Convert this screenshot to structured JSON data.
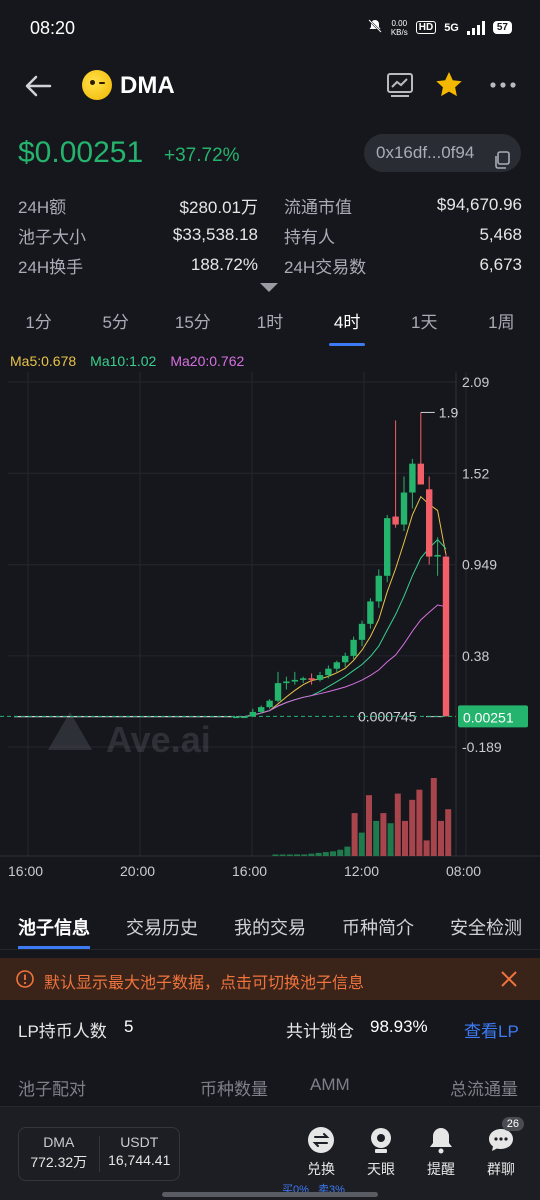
{
  "status_bar": {
    "time": "08:20",
    "net_speed_value": "0.00",
    "net_speed_unit": "KB/s",
    "hd": "HD",
    "network": "5G",
    "battery": "57"
  },
  "header": {
    "token": "DMA",
    "logo_icon": "smile-coin-icon"
  },
  "price": {
    "value": "$0.00251",
    "change": "+37.72%",
    "address": "0x16df...0f94"
  },
  "stats": [
    {
      "label": "24H额",
      "value": "$280.01万",
      "label2": "流通市值",
      "value2": "$94,670.96"
    },
    {
      "label": "池子大小",
      "value": "$33,538.18",
      "label2": "持有人",
      "value2": "5,468"
    },
    {
      "label": "24H换手",
      "value": "188.72%",
      "label2": "24H交易数",
      "value2": "6,673"
    }
  ],
  "timeframes": [
    "1分",
    "5分",
    "15分",
    "1时",
    "4时",
    "1天",
    "1周"
  ],
  "active_timeframe": "4时",
  "ma_legend": {
    "ma5": "Ma5:0.678",
    "ma10": "Ma10:1.02",
    "ma20": "Ma20:0.762"
  },
  "colors": {
    "up": "#25b46e",
    "down": "#f35f68",
    "ma5": "#e8c24a",
    "ma10": "#3ad08f",
    "ma20": "#d670e0",
    "accent": "#3d7bf5"
  },
  "chart_data": {
    "type": "candlestick",
    "y_ticks": [
      "2.09",
      "1.52",
      "0.949",
      "0.38",
      "-0.189"
    ],
    "x_ticks": [
      "16:00",
      "20:00",
      "16:00",
      "12:00",
      "08:00"
    ],
    "high_label": "1.9",
    "low_label": "0.000745",
    "last_price_label": "0.00251",
    "watermark": "Ave.ai",
    "ylim": [
      -0.189,
      2.09
    ],
    "candles": [
      {
        "o": 0.0008,
        "h": 0.0009,
        "l": 0.0007,
        "c": 0.0009
      },
      {
        "o": 0.0009,
        "h": 0.001,
        "l": 0.0008,
        "c": 0.001
      },
      {
        "o": 0.001,
        "h": 0.05,
        "l": 0.0009,
        "c": 0.03
      },
      {
        "o": 0.03,
        "h": 0.07,
        "l": 0.02,
        "c": 0.06
      },
      {
        "o": 0.06,
        "h": 0.11,
        "l": 0.05,
        "c": 0.1
      },
      {
        "o": 0.1,
        "h": 0.28,
        "l": 0.09,
        "c": 0.21
      },
      {
        "o": 0.21,
        "h": 0.25,
        "l": 0.17,
        "c": 0.22
      },
      {
        "o": 0.22,
        "h": 0.28,
        "l": 0.2,
        "c": 0.23
      },
      {
        "o": 0.23,
        "h": 0.25,
        "l": 0.21,
        "c": 0.24
      },
      {
        "o": 0.24,
        "h": 0.27,
        "l": 0.2,
        "c": 0.23
      },
      {
        "o": 0.23,
        "h": 0.28,
        "l": 0.22,
        "c": 0.26
      },
      {
        "o": 0.26,
        "h": 0.32,
        "l": 0.24,
        "c": 0.3
      },
      {
        "o": 0.3,
        "h": 0.35,
        "l": 0.28,
        "c": 0.34
      },
      {
        "o": 0.34,
        "h": 0.4,
        "l": 0.31,
        "c": 0.38
      },
      {
        "o": 0.38,
        "h": 0.5,
        "l": 0.36,
        "c": 0.48
      },
      {
        "o": 0.48,
        "h": 0.6,
        "l": 0.44,
        "c": 0.58
      },
      {
        "o": 0.58,
        "h": 0.74,
        "l": 0.55,
        "c": 0.72
      },
      {
        "o": 0.72,
        "h": 0.92,
        "l": 0.68,
        "c": 0.88
      },
      {
        "o": 0.88,
        "h": 1.26,
        "l": 0.84,
        "c": 1.24
      },
      {
        "o": 1.25,
        "h": 1.85,
        "l": 1.18,
        "c": 1.2
      },
      {
        "o": 1.2,
        "h": 1.5,
        "l": 1.16,
        "c": 1.4
      },
      {
        "o": 1.4,
        "h": 1.61,
        "l": 1.3,
        "c": 1.58
      },
      {
        "o": 1.58,
        "h": 1.9,
        "l": 1.5,
        "c": 1.45
      },
      {
        "o": 1.42,
        "h": 1.5,
        "l": 0.95,
        "c": 1.0
      },
      {
        "o": 1.0,
        "h": 1.12,
        "l": 0.88,
        "c": 1.01
      },
      {
        "o": 1.0,
        "h": 1.02,
        "l": 0.00075,
        "c": 0.0025
      }
    ],
    "volumes": [
      0,
      0,
      0,
      0,
      0,
      0,
      0,
      0,
      0,
      0,
      0,
      0,
      0.01,
      0.01,
      0.01,
      0.02,
      0.02,
      0.03,
      0.04,
      0.05,
      0.06,
      0.08,
      0.12,
      0.55,
      0.3,
      0.78,
      0.45,
      0.55,
      0.42,
      0.8,
      0.45,
      0.72,
      0.85,
      0.2,
      1.0,
      0.45,
      0.6
    ]
  },
  "bottom_tabs": [
    "池子信息",
    "交易历史",
    "我的交易",
    "币种简介",
    "安全检测"
  ],
  "notice": "默认显示最大池子数据，点击可切换池子信息",
  "lp": {
    "holders_label": "LP持币人数",
    "holders_value": "5",
    "locked_label": "共计锁仓",
    "locked_value": "98.93%",
    "view_lp": "查看LP"
  },
  "pair_head": {
    "pair": "池子配对",
    "qty": "币种数量",
    "amm": "AMM",
    "liquidity": "总流通量"
  },
  "bottom_bar": {
    "token_a": "DMA",
    "token_a_amount": "772.32万",
    "token_b": "USDT",
    "token_b_amount": "16,744.41",
    "swap": "兑换",
    "eye": "天眼",
    "alert": "提醒",
    "chat": "群聊",
    "chat_badge": "26",
    "buy_fee": "买0%",
    "sell_fee": "卖3%"
  }
}
